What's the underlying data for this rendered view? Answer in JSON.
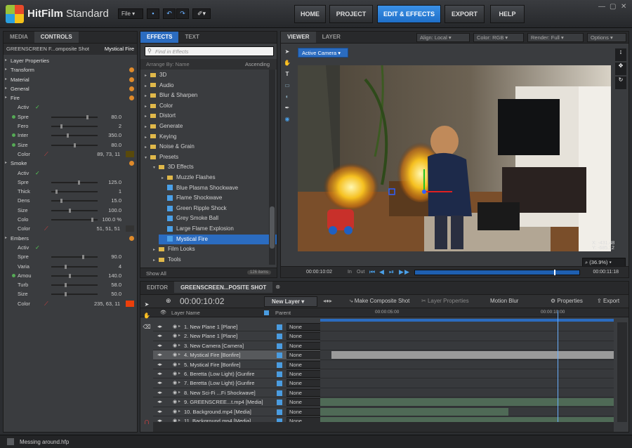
{
  "app": {
    "name_bold": "HitFilm",
    "name_light": " Standard",
    "file_menu": "File",
    "status": "Messing around.hfp"
  },
  "nav": [
    {
      "label": "HOME"
    },
    {
      "label": "PROJECT"
    },
    {
      "label": "EDIT & EFFECTS"
    },
    {
      "label": "EXPORT"
    },
    {
      "label": "HELP"
    }
  ],
  "left": {
    "tabs": [
      "MEDIA",
      "CONTROLS"
    ],
    "breadcrumb_a": "GREENSCREEN F...omposite Shot",
    "breadcrumb_b": "Mystical Fire",
    "rows": [
      {
        "type": "group",
        "label": "Layer Properties"
      },
      {
        "type": "group",
        "label": "Transform",
        "ora": true
      },
      {
        "type": "group",
        "label": "Material",
        "ora": true
      },
      {
        "type": "group",
        "label": "General",
        "ora": true
      },
      {
        "type": "group",
        "label": "Fire",
        "ora": true
      },
      {
        "type": "prop",
        "label": "Activ",
        "check": true
      },
      {
        "type": "prop",
        "label": "Spre",
        "value": "80.0",
        "dot": true,
        "slider": 0.8
      },
      {
        "type": "prop",
        "label": "Fero",
        "value": "2",
        "slider": 0.2
      },
      {
        "type": "prop",
        "label": "Inter",
        "value": "350.0",
        "dot": true,
        "slider": 0.35
      },
      {
        "type": "prop",
        "label": "Size",
        "value": "80.0",
        "dot": true,
        "slider": 0.5
      },
      {
        "type": "prop",
        "label": "Color",
        "value": "89, 73, 11",
        "color": "#59490b"
      },
      {
        "type": "group",
        "label": "Smoke",
        "ora": true
      },
      {
        "type": "prop",
        "label": "Activ",
        "check": true
      },
      {
        "type": "prop",
        "label": "Spre",
        "value": "125.0",
        "slider": 0.6
      },
      {
        "type": "prop",
        "label": "Thick",
        "value": "1",
        "slider": 0.1
      },
      {
        "type": "prop",
        "label": "Dens",
        "value": "15.0",
        "slider": 0.2
      },
      {
        "type": "prop",
        "label": "Size",
        "value": "100.0",
        "slider": 0.4
      },
      {
        "type": "prop",
        "label": "Colo",
        "value": "100.0 %",
        "slider": 0.9
      },
      {
        "type": "prop",
        "label": "Color",
        "value": "51, 51, 51",
        "color": "#333333"
      },
      {
        "type": "group",
        "label": "Embers",
        "ora": true
      },
      {
        "type": "prop",
        "label": "Activ",
        "check": true
      },
      {
        "type": "prop",
        "label": "Spre",
        "value": "90.0",
        "slider": 0.7
      },
      {
        "type": "prop",
        "label": "Varia",
        "value": "4",
        "slider": 0.3
      },
      {
        "type": "prop",
        "label": "Amou",
        "value": "140.0",
        "dot": true,
        "slider": 0.4
      },
      {
        "type": "prop",
        "label": "Turb",
        "value": "58.0",
        "slider": 0.3
      },
      {
        "type": "prop",
        "label": "Size",
        "value": "50.0",
        "slider": 0.3
      },
      {
        "type": "prop",
        "label": "Color",
        "value": "235, 63, 11",
        "color": "#eb3f0b"
      }
    ]
  },
  "effects": {
    "tabs": [
      "EFFECTS",
      "TEXT"
    ],
    "search_placeholder": "Find in Effects",
    "arrange": "Arrange By: Name",
    "order": "Ascending",
    "items": [
      {
        "label": "3D",
        "indent": 0,
        "kind": "folder"
      },
      {
        "label": "Audio",
        "indent": 0,
        "kind": "folder"
      },
      {
        "label": "Blur & Sharpen",
        "indent": 0,
        "kind": "folder"
      },
      {
        "label": "Color",
        "indent": 0,
        "kind": "folder"
      },
      {
        "label": "Distort",
        "indent": 0,
        "kind": "folder"
      },
      {
        "label": "Generate",
        "indent": 0,
        "kind": "folder"
      },
      {
        "label": "Keying",
        "indent": 0,
        "kind": "folder"
      },
      {
        "label": "Noise & Grain",
        "indent": 0,
        "kind": "folder"
      },
      {
        "label": "Presets",
        "indent": 0,
        "kind": "folder",
        "open": true
      },
      {
        "label": "3D Effects",
        "indent": 1,
        "kind": "folder",
        "open": true
      },
      {
        "label": "Muzzle Flashes",
        "indent": 2,
        "kind": "folder"
      },
      {
        "label": "Blue Plasma Shockwave",
        "indent": 2,
        "kind": "fx"
      },
      {
        "label": "Flame Shockwave",
        "indent": 2,
        "kind": "fx"
      },
      {
        "label": "Green Ripple Shock",
        "indent": 2,
        "kind": "fx"
      },
      {
        "label": "Grey Smoke Ball",
        "indent": 2,
        "kind": "fx"
      },
      {
        "label": "Large Flame Explosion",
        "indent": 2,
        "kind": "fx"
      },
      {
        "label": "Mystical Fire",
        "indent": 2,
        "kind": "fx",
        "selected": true
      },
      {
        "label": "Film Looks",
        "indent": 1,
        "kind": "folder"
      },
      {
        "label": "Tools",
        "indent": 1,
        "kind": "folder"
      }
    ],
    "show": "Show All",
    "count": "126 items"
  },
  "viewer": {
    "tabs": [
      "VIEWER",
      "LAYER"
    ],
    "align": "Align: Local",
    "color": "Color: RGB",
    "render": "Render: Full",
    "options": "Options",
    "camera": "Active Camera",
    "coord_x": "X:   -431.48",
    "coord_y": "Y:   -685.12",
    "zoom": "(36.9%)",
    "time_start": "00:00:10:02",
    "in_label": "In",
    "out_label": "Out",
    "time_end": "00:00:11:18"
  },
  "editor": {
    "tabs": [
      "EDITOR",
      "GREENSCREEN...POSITE SHOT"
    ],
    "timecode": "00:00:10:02",
    "new_layer": "New Layer",
    "make_composite": "Make Composite Shot",
    "layer_props": "Layer Properties",
    "motion_blur": "Motion Blur",
    "properties": "Properties",
    "export": "Export",
    "col_layer": "Layer Name",
    "col_parent": "Parent",
    "ruler_a": "00:00:05:00",
    "ruler_b": "00:00:10:00",
    "layers": [
      {
        "name": "1. New Plane 1 [Plane]",
        "parent": "None"
      },
      {
        "name": "2. New Plane 1 [Plane]",
        "parent": "None"
      },
      {
        "name": "3. New Camera [Camera]",
        "parent": "None"
      },
      {
        "name": "4. Mystical Fire [Bonfire]",
        "parent": "None",
        "selected": true
      },
      {
        "name": "5. Mystical Fire [Bonfire]",
        "parent": "None"
      },
      {
        "name": "6. Beretta (Low Light) [Gunfire",
        "parent": "None"
      },
      {
        "name": "7. Beretta (Low Light) [Gunfire",
        "parent": "None"
      },
      {
        "name": "8. New Sci-Fi ...Fi Shockwave]",
        "parent": "None"
      },
      {
        "name": "9. GREENSCREE...t.mp4 [Media]",
        "parent": "None"
      },
      {
        "name": "10. Background.mp4 [Media]",
        "parent": "None"
      },
      {
        "name": "11. Background.mp4 [Media]",
        "parent": "None"
      }
    ]
  }
}
